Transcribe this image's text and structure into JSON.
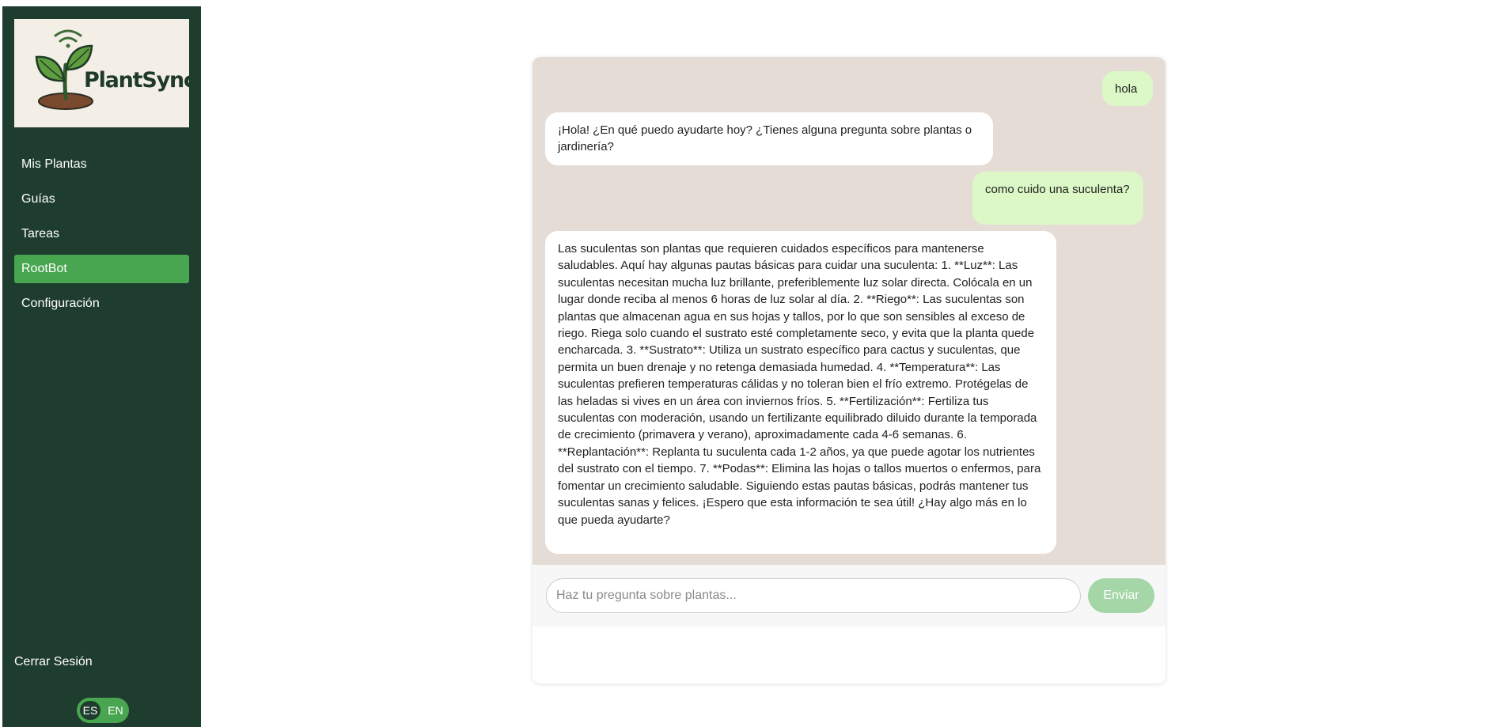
{
  "app": {
    "name": "PlantSync"
  },
  "sidebar": {
    "items": [
      {
        "label": "Mis Plantas",
        "active": false
      },
      {
        "label": "Guías",
        "active": false
      },
      {
        "label": "Tareas",
        "active": false
      },
      {
        "label": "RootBot",
        "active": true
      },
      {
        "label": "Configuración",
        "active": false
      }
    ],
    "logout_label": "Cerrar Sesión",
    "language": {
      "options": [
        "ES",
        "EN"
      ],
      "selected": "ES"
    }
  },
  "chat": {
    "messages": [
      {
        "role": "user",
        "text": "hola"
      },
      {
        "role": "bot",
        "text": "¡Hola! ¿En qué puedo ayudarte hoy? ¿Tienes alguna pregunta sobre plantas o jardinería?"
      },
      {
        "role": "user",
        "text": "como cuido una suculenta?"
      },
      {
        "role": "bot",
        "text": "Las suculentas son plantas que requieren cuidados específicos para mantenerse saludables. Aquí hay algunas pautas básicas para cuidar una suculenta: 1. **Luz**: Las suculentas necesitan mucha luz brillante, preferiblemente luz solar directa. Colócala en un lugar donde reciba al menos 6 horas de luz solar al día. 2. **Riego**: Las suculentas son plantas que almacenan agua en sus hojas y tallos, por lo que son sensibles al exceso de riego. Riega solo cuando el sustrato esté completamente seco, y evita que la planta quede encharcada. 3. **Sustrato**: Utiliza un sustrato específico para cactus y suculentas, que permita un buen drenaje y no retenga demasiada humedad. 4. **Temperatura**: Las suculentas prefieren temperaturas cálidas y no toleran bien el frío extremo. Protégelas de las heladas si vives en un área con inviernos fríos. 5. **Fertilización**: Fertiliza tus suculentas con moderación, usando un fertilizante equilibrado diluido durante la temporada de crecimiento (primavera y verano), aproximadamente cada 4-6 semanas. 6. **Replantación**: Replanta tu suculenta cada 1-2 años, ya que puede agotar los nutrientes del sustrato con el tiempo. 7. **Podas**: Elimina las hojas o tallos muertos o enfermos, para fomentar un crecimiento saludable. Siguiendo estas pautas básicas, podrás mantener tus suculentas sanas y felices. ¡Espero que esta información te sea útil! ¿Hay algo más en lo que pueda ayudarte?"
      }
    ],
    "input": {
      "placeholder": "Haz tu pregunta sobre plantas...",
      "value": ""
    },
    "send_label": "Enviar"
  },
  "colors": {
    "sidebar_bg": "#1f3d2f",
    "accent": "#49a650",
    "chat_bg": "#e5ddd5",
    "user_bubble": "#dcf8c6",
    "bot_bubble": "#ffffff",
    "send_disabled": "#a5d6a7"
  },
  "icons": {
    "logo": "sprout-with-wifi-icon"
  }
}
